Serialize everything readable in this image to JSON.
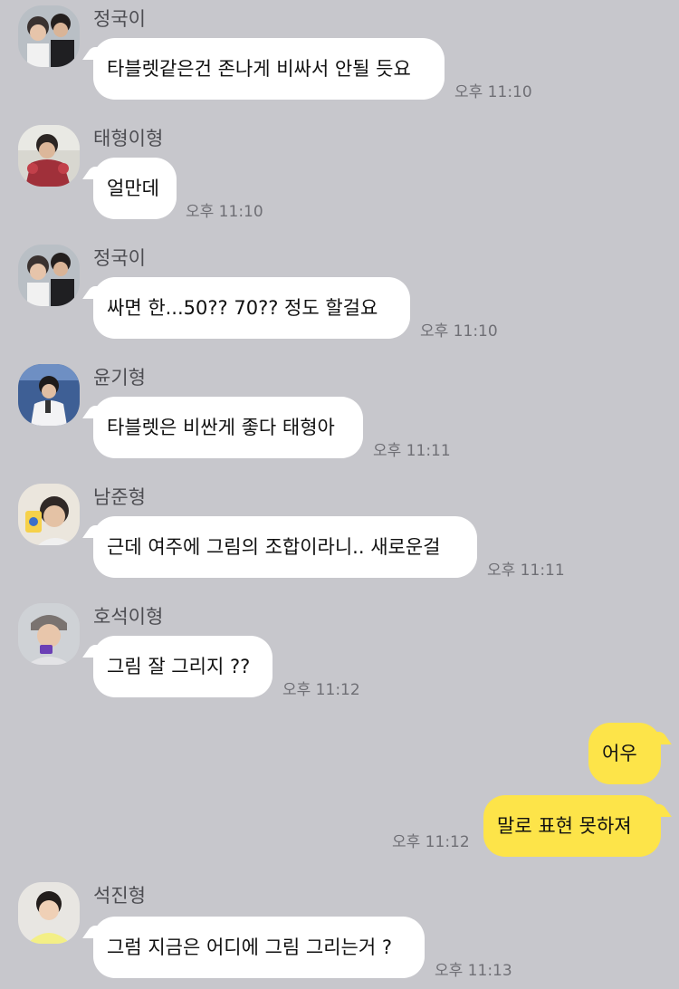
{
  "messages": [
    {
      "sender": "정국이",
      "avatar": "sender-avatar",
      "text": "타블렛같은건 존나게 비싸서 안될 듯요",
      "time": "오후 11:10",
      "direction": "incoming"
    },
    {
      "sender": "태형이형",
      "avatar": "sender-avatar",
      "text": "얼만데",
      "time": "오후 11:10",
      "direction": "incoming"
    },
    {
      "sender": "정국이",
      "avatar": "sender-avatar",
      "text": "싸면 한...50?? 70?? 정도 할걸요",
      "time": "오후 11:10",
      "direction": "incoming"
    },
    {
      "sender": "윤기형",
      "avatar": "sender-avatar",
      "text": "타블렛은 비싼게 좋다 태형아",
      "time": "오후 11:11",
      "direction": "incoming"
    },
    {
      "sender": "남준형",
      "avatar": "sender-avatar",
      "text": "근데 여주에 그림의 조합이라니.. 새로운걸",
      "time": "오후 11:11",
      "direction": "incoming"
    },
    {
      "sender": "호석이형",
      "avatar": "sender-avatar",
      "text": "그림 잘 그리지 ??",
      "time": "오후 11:12",
      "direction": "incoming"
    },
    {
      "text": "어우",
      "direction": "outgoing"
    },
    {
      "text": "말로 표현 못하져",
      "time": "오후 11:12",
      "direction": "outgoing"
    },
    {
      "sender": "석진형",
      "avatar": "sender-avatar",
      "text": "그럼 지금은 어디에 그림 그리는거 ?",
      "time": "오후 11:13",
      "direction": "incoming"
    }
  ],
  "colors": {
    "background": "#c7c7cc",
    "incoming_bubble": "#ffffff",
    "outgoing_bubble": "#fde449",
    "sender_name": "#4d4d52",
    "timestamp": "#6f6f75"
  }
}
